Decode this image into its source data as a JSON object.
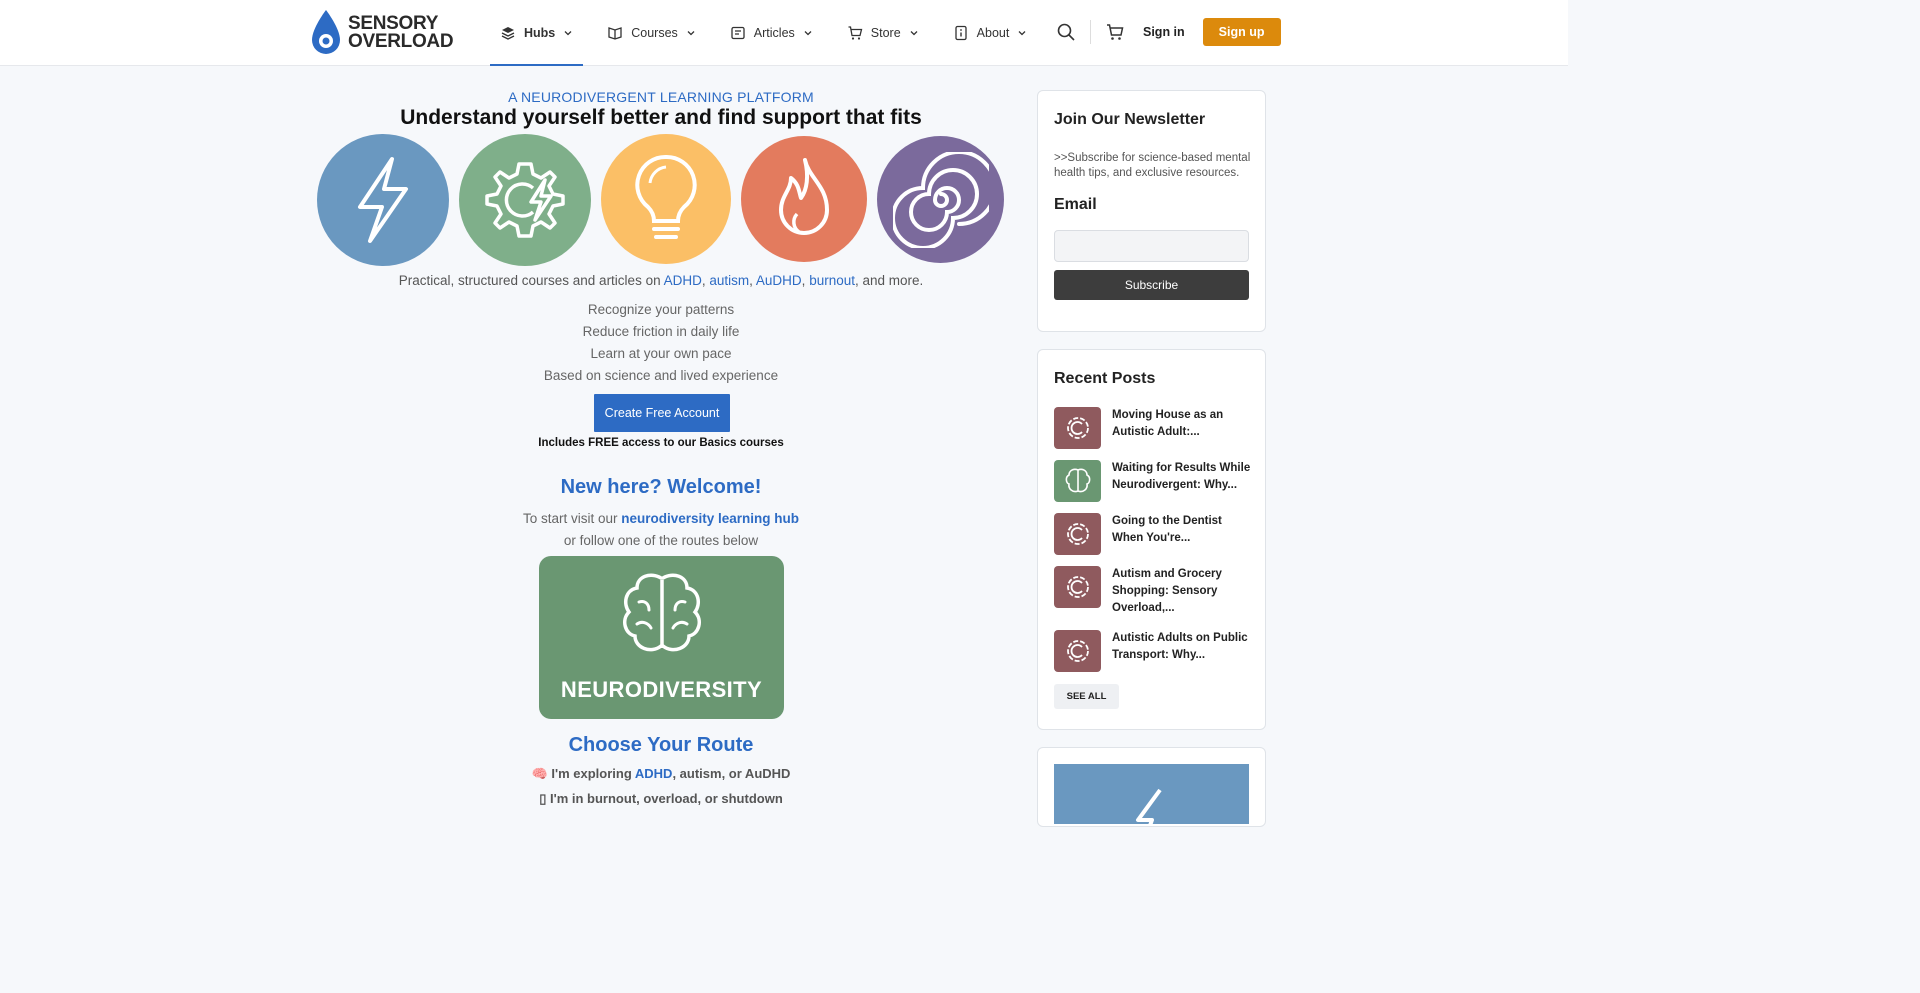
{
  "header": {
    "logo_line1": "SENSORY",
    "logo_line2": "OVERLOAD",
    "nav": [
      {
        "label": "Hubs",
        "icon": "layers-icon"
      },
      {
        "label": "Courses",
        "icon": "book-icon"
      },
      {
        "label": "Articles",
        "icon": "article-icon"
      },
      {
        "label": "Store",
        "icon": "cart-icon"
      },
      {
        "label": "About",
        "icon": "info-icon"
      }
    ],
    "signin": "Sign in",
    "signup": "Sign up"
  },
  "hero": {
    "eyebrow": "A NEURODIVERGENT LEARNING PLATFORM",
    "headline": "Understand yourself better and find support that fits",
    "hubs": [
      {
        "name": "lightning",
        "color": "#6a98c0"
      },
      {
        "name": "gear-lightning",
        "color": "#7faf8a"
      },
      {
        "name": "lightbulb",
        "color": "#fbbf66"
      },
      {
        "name": "flame",
        "color": "#e37b5e"
      },
      {
        "name": "spiral",
        "color": "#7b6a9c"
      }
    ],
    "intro_prefix": "Practical, structured courses and articles on ",
    "link_adhd": "ADHD",
    "sep1": ", ",
    "link_autism": "autism",
    "sep2": ", ",
    "link_audhd": "AuDHD",
    "sep3": ", ",
    "link_burnout": "burnout",
    "intro_suffix": ", and more.",
    "bullets": [
      "Recognize your patterns",
      "Reduce friction in daily life",
      "Learn at your own pace",
      "Based on science and lived experience"
    ],
    "cta": "Create Free Account",
    "cta_note": "Includes FREE access to our Basics courses"
  },
  "welcome": {
    "title": "New here? Welcome!",
    "line1_prefix": "To start visit our ",
    "line1_link": "neurodiversity learning hub",
    "line2": "or follow one of the routes below",
    "card_label": "NEURODIVERSITY"
  },
  "routes": {
    "title": "Choose Your Route",
    "r1_emoji": "🧠",
    "r1_prefix": "I'm exploring ",
    "r1_link": "ADHD",
    "r1_suffix": ", autism, or AuDHD",
    "r2_emoji": "▯",
    "r2_text": "I'm in burnout, overload, or shutdown"
  },
  "newsletter": {
    "title": "Join Our Newsletter",
    "text": ">>Subscribe for science-based mental health tips, and exclusive resources.",
    "email_label": "Email",
    "email_value": "",
    "button": "Subscribe"
  },
  "recent": {
    "title": "Recent Posts",
    "posts": [
      {
        "title": "Moving House as an Autistic Adult:...",
        "thumb_color": "#8f5a5e"
      },
      {
        "title": "Waiting for Results While Neurodivergent: Why...",
        "thumb_color": "#6a9772"
      },
      {
        "title": "Going to the Dentist When You're...",
        "thumb_color": "#8f5a5e"
      },
      {
        "title": "Autism and Grocery Shopping: Sensory Overload,...",
        "thumb_color": "#8f5a5e"
      },
      {
        "title": "Autistic Adults on Public Transport: Why...",
        "thumb_color": "#8f5a5e"
      }
    ],
    "see_all": "SEE ALL"
  }
}
